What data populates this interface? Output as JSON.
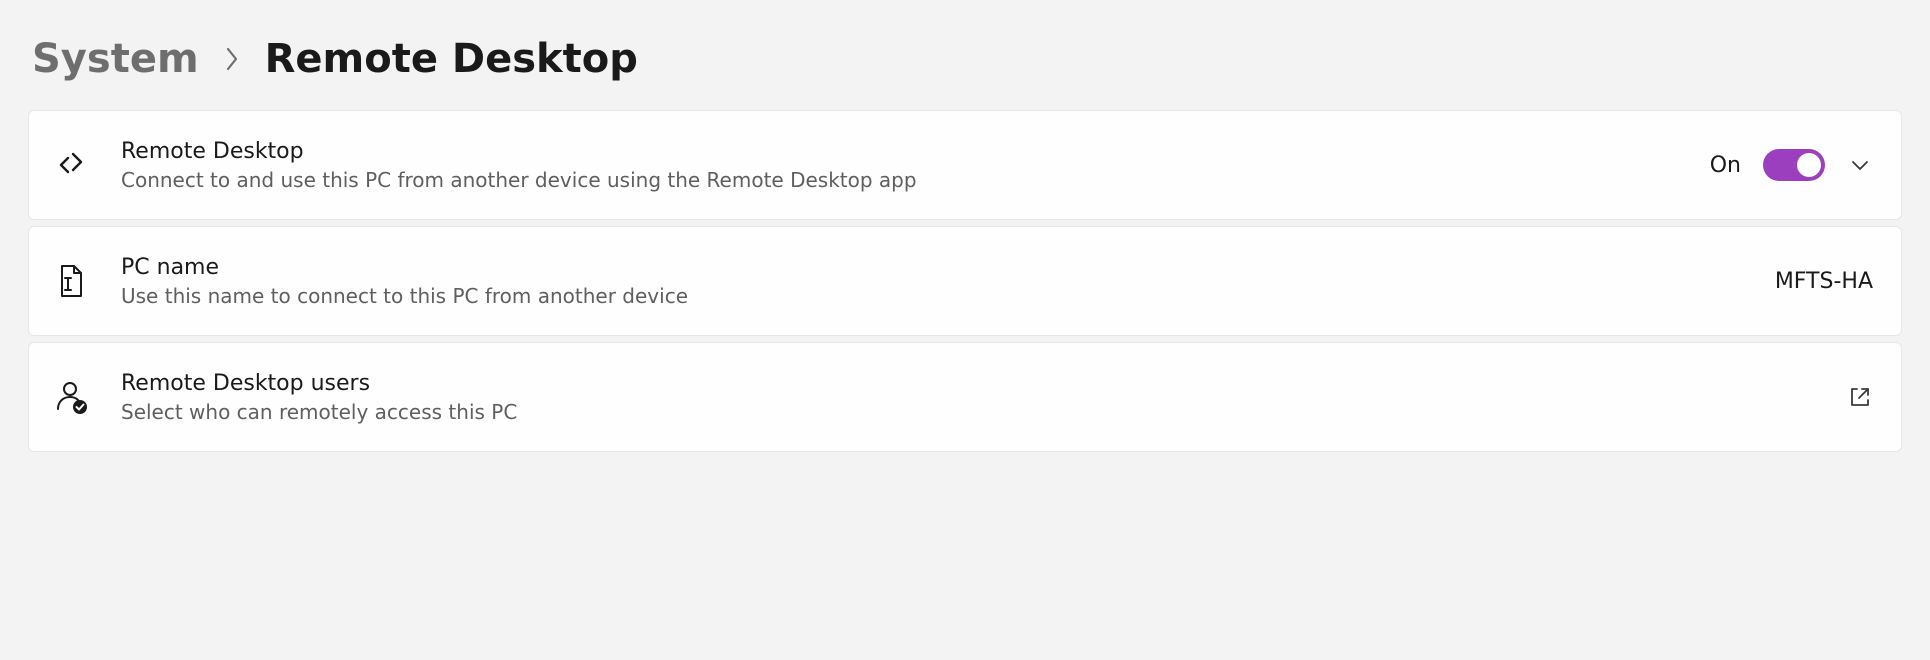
{
  "breadcrumb": {
    "parent": "System",
    "current": "Remote Desktop"
  },
  "cards": {
    "remote_desktop": {
      "title": "Remote Desktop",
      "desc": "Connect to and use this PC from another device using the Remote Desktop app",
      "status_label": "On"
    },
    "pc_name": {
      "title": "PC name",
      "desc": "Use this name to connect to this PC from another device",
      "value": "MFTS-HA"
    },
    "users": {
      "title": "Remote Desktop users",
      "desc": "Select who can remotely access this PC"
    }
  }
}
